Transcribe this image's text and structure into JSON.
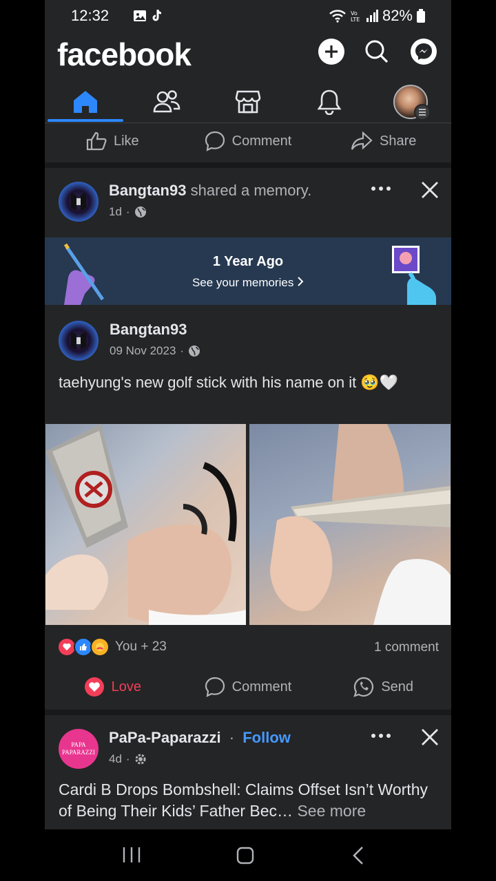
{
  "status_bar": {
    "time": "12:32",
    "battery": "82%"
  },
  "header": {
    "logo": "facebook"
  },
  "nav": {
    "items": [
      "home-icon",
      "friends-icon",
      "marketplace-icon",
      "notifications-icon",
      "profile-avatar"
    ]
  },
  "top_actions": {
    "like": "Like",
    "comment": "Comment",
    "share": "Share"
  },
  "memory_post": {
    "author": "Bangtan93",
    "action": "shared a memory.",
    "time": "1d",
    "banner_title": "1 Year Ago",
    "banner_link": "See your memories",
    "original": {
      "author": "Bangtan93",
      "date": "09 Nov 2023",
      "text": "taehyung's new golf stick with his name on it 🥹🤍"
    },
    "reactions_text": "You + 23",
    "comments": "1 comment",
    "actions": {
      "love": "Love",
      "comment": "Comment",
      "send": "Send"
    }
  },
  "next_post": {
    "page_name": "PaPa-Paparazzi",
    "follow": "Follow",
    "time": "4d",
    "avatar_text": "PAPA PAPARAZZI",
    "text": "Cardi B Drops Bombshell: Claims Offset Isn’t Worthy of Being Their Kids’ Father Bec…",
    "see_more": "See more"
  },
  "colors": {
    "accent": "#2d88ff",
    "love": "#f33e58",
    "background": "#242526"
  }
}
